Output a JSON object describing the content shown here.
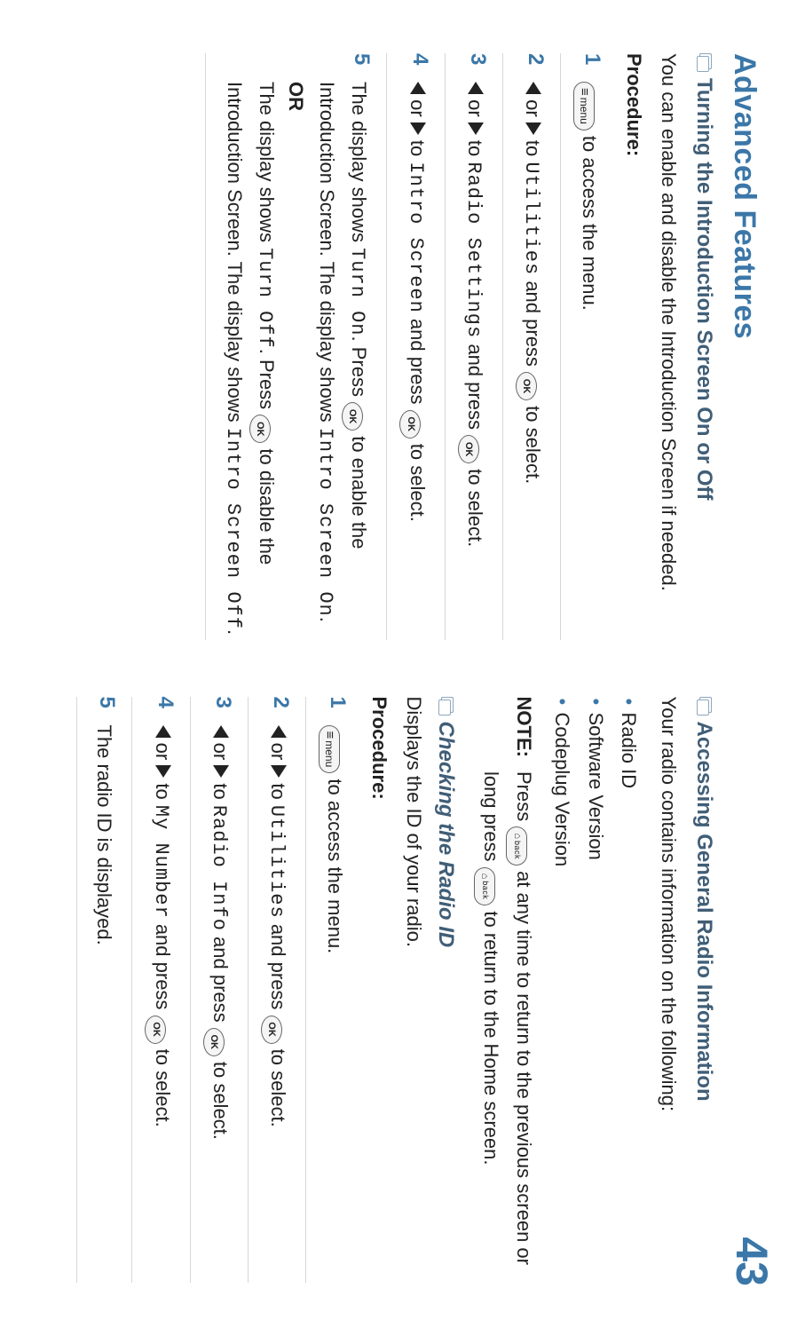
{
  "header": {
    "title": "Advanced Features",
    "page_number": "43"
  },
  "left": {
    "section_title": "Turning the Introduction Screen On or Off",
    "intro": "You can enable and disable the Introduction Screen if needed.",
    "procedure_label": "Procedure:",
    "steps": {
      "s1": {
        "num": "1",
        "a": " to access the menu."
      },
      "s2": {
        "num": "2",
        "a": " or ",
        "b": " to ",
        "c": "Utilities",
        "d": " and press ",
        "e": " to select."
      },
      "s3": {
        "num": "3",
        "a": " or ",
        "b": " to ",
        "c": "Radio Settings",
        "d": " and press ",
        "e": " to select."
      },
      "s4": {
        "num": "4",
        "a": " or ",
        "b": " to ",
        "c": "Intro Screen",
        "d": " and press ",
        "e": " to select."
      },
      "s5": {
        "num": "5",
        "p1a": "The display shows ",
        "p1b": "Turn On",
        "p1c": ". Press ",
        "p1d": " to enable the Introduction Screen. The display shows ",
        "p1e": "Intro Screen On",
        "p1f": ".",
        "or": "OR",
        "p2a": "The display shows ",
        "p2b": "Turn Off",
        "p2c": ". Press ",
        "p2d": " to disable the Introduction Screen. The display shows ",
        "p2e": "Intro Screen Off",
        "p2f": "."
      }
    }
  },
  "right": {
    "section_title": "Accessing General Radio Information",
    "intro": "Your radio contains information on the following:",
    "bullets": {
      "b1": "Radio ID",
      "b2": "Software Version",
      "b3": "Codeplug Version"
    },
    "note_label": "NOTE:",
    "note_a": "Press ",
    "note_b": " at any time to return to the previous screen or long press ",
    "note_c": " to return to the Home screen.",
    "sub_title": "Checking the Radio ID",
    "sub_intro": "Displays the ID of your radio.",
    "procedure_label": "Procedure:",
    "steps": {
      "s1": {
        "num": "1",
        "a": " to access the menu."
      },
      "s2": {
        "num": "2",
        "a": " or ",
        "b": " to ",
        "c": "Utilities",
        "d": " and press ",
        "e": " to select."
      },
      "s3": {
        "num": "3",
        "a": " or ",
        "b": " to ",
        "c": "Radio Info",
        "d": " and press ",
        "e": " to select."
      },
      "s4": {
        "num": "4",
        "a": " or ",
        "b": " to ",
        "c": "My Number",
        "d": " and press ",
        "e": " to select."
      },
      "s5": {
        "num": "5",
        "a": "The radio ID is displayed."
      }
    }
  },
  "keys": {
    "menu": "menu",
    "ok": "OK",
    "back_label": "back"
  }
}
